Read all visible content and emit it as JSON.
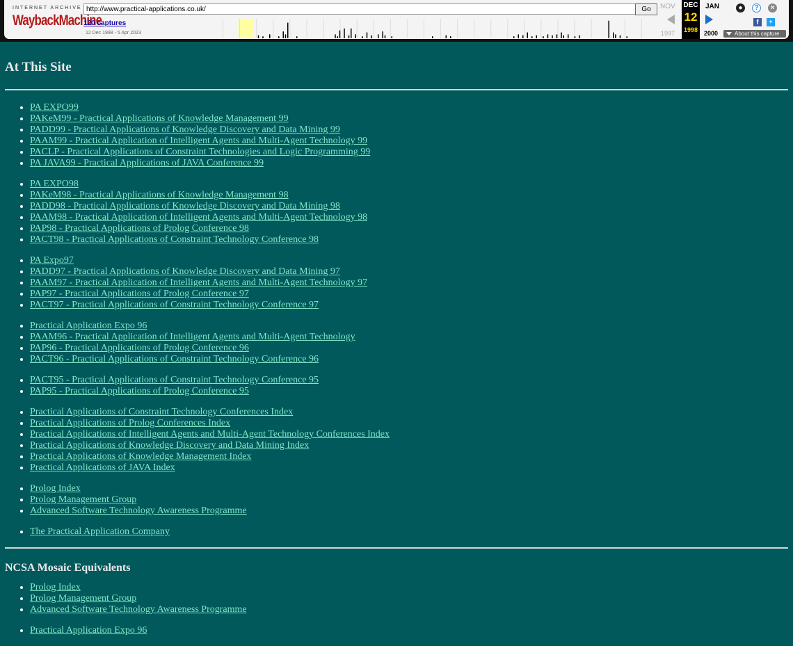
{
  "toolbar": {
    "ia_label": "INTERNET ARCHIVE",
    "logo": "WaybackMachine",
    "url": "http://www.practical-applications.co.uk/",
    "go_label": "Go",
    "captures": "120 captures",
    "date_range": "12 Dec 1998 - 5 Apr 2023",
    "prev_month": "NOV",
    "cur_month": "DEC",
    "cur_day": "12",
    "cur_year": "1998",
    "next_month": "JAN",
    "prev_year": "1997",
    "next_year": "2000",
    "about_label": "About this capture",
    "sparkline_bars": [
      {
        "pos": 0.115,
        "h": 0.15
      },
      {
        "pos": 0.125,
        "h": 0.1
      },
      {
        "pos": 0.14,
        "h": 0.2
      },
      {
        "pos": 0.16,
        "h": 0.1
      },
      {
        "pos": 0.17,
        "h": 0.35
      },
      {
        "pos": 0.175,
        "h": 0.2
      },
      {
        "pos": 0.18,
        "h": 0.8
      },
      {
        "pos": 0.2,
        "h": 0.1
      },
      {
        "pos": 0.285,
        "h": 0.2
      },
      {
        "pos": 0.29,
        "h": 0.1
      },
      {
        "pos": 0.295,
        "h": 0.4
      },
      {
        "pos": 0.305,
        "h": 0.5
      },
      {
        "pos": 0.315,
        "h": 0.15
      },
      {
        "pos": 0.32,
        "h": 0.5
      },
      {
        "pos": 0.33,
        "h": 0.2
      },
      {
        "pos": 0.345,
        "h": 0.1
      },
      {
        "pos": 0.355,
        "h": 0.3
      },
      {
        "pos": 0.365,
        "h": 0.15
      },
      {
        "pos": 0.38,
        "h": 0.2
      },
      {
        "pos": 0.39,
        "h": 0.35
      },
      {
        "pos": 0.395,
        "h": 0.15
      },
      {
        "pos": 0.41,
        "h": 0.1
      },
      {
        "pos": 0.5,
        "h": 0.1
      },
      {
        "pos": 0.53,
        "h": 0.15
      },
      {
        "pos": 0.54,
        "h": 0.1
      },
      {
        "pos": 0.68,
        "h": 0.1
      },
      {
        "pos": 0.69,
        "h": 0.2
      },
      {
        "pos": 0.7,
        "h": 0.15
      },
      {
        "pos": 0.71,
        "h": 0.3
      },
      {
        "pos": 0.72,
        "h": 0.1
      },
      {
        "pos": 0.73,
        "h": 0.15
      },
      {
        "pos": 0.745,
        "h": 0.1
      },
      {
        "pos": 0.755,
        "h": 0.2
      },
      {
        "pos": 0.765,
        "h": 0.15
      },
      {
        "pos": 0.775,
        "h": 0.2
      },
      {
        "pos": 0.785,
        "h": 0.3
      },
      {
        "pos": 0.79,
        "h": 0.15
      },
      {
        "pos": 0.8,
        "h": 0.2
      },
      {
        "pos": 0.815,
        "h": 0.1
      },
      {
        "pos": 0.825,
        "h": 0.15
      },
      {
        "pos": 0.89,
        "h": 0.9
      },
      {
        "pos": 0.9,
        "h": 0.3
      },
      {
        "pos": 0.905,
        "h": 0.2
      },
      {
        "pos": 0.915,
        "h": 0.15
      },
      {
        "pos": 0.93,
        "h": 0.1
      }
    ],
    "sparkline_highlight": 0.072
  },
  "at_this_site": {
    "title": "At This Site",
    "groups": [
      [
        "PA EXPO99",
        "PAKeM99 - Practical Applications of Knowledge Management 99",
        "PADD99 - Practical Applications of Knowledge Discovery and Data Mining 99",
        "PAAM99 - Practical Application of Intelligent Agents and Multi-Agent Technology 99",
        "PACLP - Practical Applications of Constraint Technologies and Logic Programming 99",
        "PA JAVA99 - Practical Applications of JAVA Conference 99"
      ],
      [
        "PA EXPO98",
        "PAKeM98 - Practical Applications of Knowledge Management 98",
        "PADD98 - Practical Applications of Knowledge Discovery and Data Mining 98",
        "PAAM98 - Practical Application of Intelligent Agents and Multi-Agent Technology 98",
        "PAP98 - Practical Applications of Prolog Conference 98",
        "PACT98 - Practical Applications of Constraint Technology Conference 98"
      ],
      [
        "PA Expo97",
        "PADD97 - Practical Applications of Knowledge Discovery and Data Mining 97",
        "PAAM97 - Practical Application of Intelligent Agents and Multi-Agent Technology 97",
        "PAP97 - Practical Applications of Prolog Conference 97",
        "PACT97 - Practical Applications of Constraint Technology Conference 97"
      ],
      [
        "Practical Application Expo 96",
        "PAAM96 - Practical Application of Intelligent Agents and Multi-Agent Technology",
        "PAP96 - Practical Applications of Prolog Conference 96",
        "PACT96 - Practical Applications of Constraint Technology Conference 96"
      ],
      [
        "PACT95 - Practical Applications of Constraint Technology Conference 95",
        "PAP95 - Practical Applications of Prolog Conference 95"
      ],
      [
        "Practical Applications of Constraint Technology Conferences Index",
        "Practical Applications of Prolog Conferences Index",
        "Practical Applications of Intelligent Agents and Multi-Agent Technology Conferences Index",
        "Practical Applications of Knowledge Discovery and Data Mining Index",
        "Practical Applications of Knowledge Management Index",
        "Practical Applications of JAVA Index"
      ],
      [
        "Prolog Index",
        "Prolog Management Group",
        "Advanced Software Technology Awareness Programme"
      ],
      [
        "The Practical Application Company"
      ]
    ]
  },
  "ncsa": {
    "title": "NCSA Mosaic Equivalents",
    "groups": [
      [
        "Prolog Index",
        "Prolog Management Group",
        "Advanced Software Technology Awareness Programme"
      ],
      [
        "Practical Application Expo 96"
      ]
    ]
  },
  "colors": {
    "background": "#01595b",
    "link": "#7fe6c8"
  }
}
